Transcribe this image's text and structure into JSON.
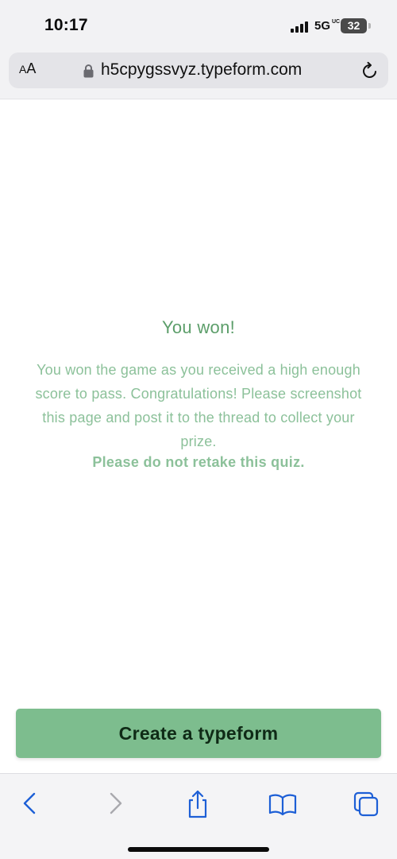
{
  "status_bar": {
    "time": "10:17",
    "network": "5G",
    "network_suffix": "UC",
    "battery": "32"
  },
  "browser": {
    "text_size_label_small": "A",
    "text_size_label_large": "A",
    "url": "h5cpygssvyz.typeform.com",
    "icons": [
      "lock-icon",
      "reload-icon"
    ]
  },
  "page": {
    "title": "You won!",
    "message": "You won the game as you received a high enough score to pass. Congratulations! Please screenshot this page and post it to the thread to collect your prize.",
    "warning": "Please do not retake this quiz.",
    "cta_label": "Create a typeform"
  },
  "toolbar": {
    "icons": [
      "back-icon",
      "forward-icon",
      "share-icon",
      "bookmarks-icon",
      "tabs-icon"
    ]
  },
  "colors": {
    "accent_green": "#7dbd8e",
    "title_green": "#5c9e6a",
    "text_green": "#8cc19a",
    "ios_blue": "#1d5fd6"
  }
}
